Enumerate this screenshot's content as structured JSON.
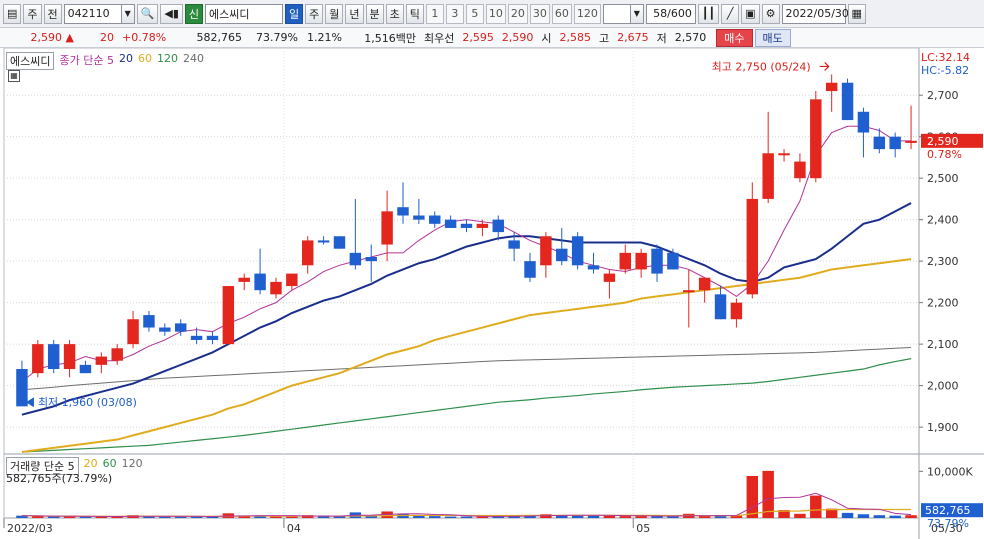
{
  "toolbar": {
    "market": "주",
    "prev_label": "전",
    "code": "042110",
    "new_label": "신",
    "name": "에스씨디",
    "periods": [
      "일",
      "주",
      "월",
      "년",
      "분",
      "초",
      "틱"
    ],
    "selected_period": "일",
    "intervals": [
      "1",
      "3",
      "5",
      "10",
      "20",
      "30",
      "60",
      "120"
    ],
    "count": "58/600",
    "date": "2022/05/30"
  },
  "quote": {
    "price": "2,590",
    "arrow": "▲",
    "change": "20",
    "change_pct": "+0.78%",
    "volume": "582,765",
    "vol_ratio": "73.79%",
    "turnover": "1.21%",
    "amount": "1,516백만",
    "best_label": "최우선",
    "ask": "2,595",
    "bid": "2,590",
    "open_label": "시",
    "open": "2,585",
    "high_label": "고",
    "high": "2,675",
    "low_label": "저",
    "low": "2,570",
    "buy_label": "매수",
    "sell_label": "매도"
  },
  "price_legend": {
    "name": "에스씨디",
    "ma_label": "종가 단순 5",
    "ma2": "20",
    "ma3": "60",
    "ma4": "120",
    "ma5": "240",
    "colors": {
      "ma5": "#b2339a",
      "ma20": "#1a2f8c",
      "ma60": "#e0ac1d",
      "ma120": "#2f8f4d",
      "ma240": "#6e6e6e"
    }
  },
  "right_labels": {
    "lc": "LC:32.14",
    "hc": "HC:-5.82",
    "current_price": "2,590",
    "current_pct": "0.78%",
    "volume_value": "582,765",
    "volume_pct": "73.79%",
    "volume_unit_tick": "10,000K"
  },
  "annotations": {
    "high": "최고 2,750 (05/24)",
    "low": "최저 1,960 (03/08)"
  },
  "volume_legend": {
    "label": "거래량 단순 5",
    "ma2": "20",
    "ma3": "60",
    "ma4": "120",
    "value": "582,765주(73.79%)"
  },
  "x_labels": [
    "2022/03",
    "04",
    "05",
    "05/30"
  ],
  "chart_data": {
    "type": "candlestick",
    "y_ticks": [
      1900,
      2000,
      2100,
      2200,
      2300,
      2400,
      2500,
      2600,
      2700
    ],
    "y_tick_labels": [
      "1,900",
      "2,000",
      "2,100",
      "2,200",
      "2,300",
      "2,400",
      "2,500",
      "2,600",
      "2,700"
    ],
    "ylim": [
      1840,
      2780
    ],
    "candles": [
      {
        "o": 2040,
        "h": 2060,
        "l": 1960,
        "c": 1950
      },
      {
        "o": 2030,
        "h": 2110,
        "l": 2020,
        "c": 2100
      },
      {
        "o": 2100,
        "h": 2110,
        "l": 2030,
        "c": 2040
      },
      {
        "o": 2040,
        "h": 2110,
        "l": 2020,
        "c": 2100
      },
      {
        "o": 2050,
        "h": 2060,
        "l": 2030,
        "c": 2030
      },
      {
        "o": 2050,
        "h": 2080,
        "l": 2030,
        "c": 2070
      },
      {
        "o": 2060,
        "h": 2100,
        "l": 2050,
        "c": 2090
      },
      {
        "o": 2100,
        "h": 2180,
        "l": 2090,
        "c": 2160
      },
      {
        "o": 2170,
        "h": 2180,
        "l": 2130,
        "c": 2140
      },
      {
        "o": 2140,
        "h": 2150,
        "l": 2120,
        "c": 2130
      },
      {
        "o": 2150,
        "h": 2160,
        "l": 2120,
        "c": 2130
      },
      {
        "o": 2120,
        "h": 2140,
        "l": 2100,
        "c": 2110
      },
      {
        "o": 2120,
        "h": 2130,
        "l": 2100,
        "c": 2110
      },
      {
        "o": 2100,
        "h": 2240,
        "l": 2100,
        "c": 2240
      },
      {
        "o": 2250,
        "h": 2270,
        "l": 2230,
        "c": 2260
      },
      {
        "o": 2270,
        "h": 2330,
        "l": 2220,
        "c": 2230
      },
      {
        "o": 2220,
        "h": 2260,
        "l": 2210,
        "c": 2250
      },
      {
        "o": 2240,
        "h": 2270,
        "l": 2230,
        "c": 2270
      },
      {
        "o": 2290,
        "h": 2360,
        "l": 2270,
        "c": 2350
      },
      {
        "o": 2350,
        "h": 2360,
        "l": 2340,
        "c": 2345
      },
      {
        "o": 2360,
        "h": 2360,
        "l": 2330,
        "c": 2330
      },
      {
        "o": 2320,
        "h": 2450,
        "l": 2280,
        "c": 2290
      },
      {
        "o": 2310,
        "h": 2340,
        "l": 2250,
        "c": 2300
      },
      {
        "o": 2340,
        "h": 2470,
        "l": 2300,
        "c": 2420
      },
      {
        "o": 2430,
        "h": 2490,
        "l": 2390,
        "c": 2410
      },
      {
        "o": 2410,
        "h": 2450,
        "l": 2390,
        "c": 2400
      },
      {
        "o": 2410,
        "h": 2420,
        "l": 2380,
        "c": 2390
      },
      {
        "o": 2400,
        "h": 2410,
        "l": 2380,
        "c": 2380
      },
      {
        "o": 2390,
        "h": 2400,
        "l": 2370,
        "c": 2380
      },
      {
        "o": 2380,
        "h": 2400,
        "l": 2360,
        "c": 2390
      },
      {
        "o": 2400,
        "h": 2410,
        "l": 2350,
        "c": 2370
      },
      {
        "o": 2350,
        "h": 2370,
        "l": 2300,
        "c": 2330
      },
      {
        "o": 2300,
        "h": 2320,
        "l": 2250,
        "c": 2260
      },
      {
        "o": 2290,
        "h": 2370,
        "l": 2260,
        "c": 2360
      },
      {
        "o": 2330,
        "h": 2380,
        "l": 2290,
        "c": 2300
      },
      {
        "o": 2360,
        "h": 2370,
        "l": 2280,
        "c": 2290
      },
      {
        "o": 2290,
        "h": 2320,
        "l": 2270,
        "c": 2280
      },
      {
        "o": 2250,
        "h": 2280,
        "l": 2210,
        "c": 2270
      },
      {
        "o": 2280,
        "h": 2340,
        "l": 2270,
        "c": 2320
      },
      {
        "o": 2280,
        "h": 2330,
        "l": 2260,
        "c": 2320
      },
      {
        "o": 2330,
        "h": 2340,
        "l": 2250,
        "c": 2270
      },
      {
        "o": 2320,
        "h": 2330,
        "l": 2280,
        "c": 2280
      },
      {
        "o": 2230,
        "h": 2280,
        "l": 2140,
        "c": 2230
      },
      {
        "o": 2230,
        "h": 2260,
        "l": 2200,
        "c": 2260
      },
      {
        "o": 2220,
        "h": 2240,
        "l": 2160,
        "c": 2160
      },
      {
        "o": 2160,
        "h": 2210,
        "l": 2140,
        "c": 2200
      },
      {
        "o": 2220,
        "h": 2490,
        "l": 2210,
        "c": 2450
      },
      {
        "o": 2450,
        "h": 2660,
        "l": 2440,
        "c": 2560
      },
      {
        "o": 2560,
        "h": 2570,
        "l": 2540,
        "c": 2560
      },
      {
        "o": 2500,
        "h": 2560,
        "l": 2490,
        "c": 2540
      },
      {
        "o": 2500,
        "h": 2710,
        "l": 2490,
        "c": 2690
      },
      {
        "o": 2710,
        "h": 2750,
        "l": 2660,
        "c": 2730
      },
      {
        "o": 2730,
        "h": 2740,
        "l": 2640,
        "c": 2640
      },
      {
        "o": 2660,
        "h": 2670,
        "l": 2550,
        "c": 2610
      },
      {
        "o": 2600,
        "h": 2620,
        "l": 2560,
        "c": 2570
      },
      {
        "o": 2600,
        "h": 2610,
        "l": 2550,
        "c": 2570
      },
      {
        "o": 2585,
        "h": 2675,
        "l": 2570,
        "c": 2590
      }
    ],
    "ma5": [
      2010,
      2040,
      2050,
      2055,
      2070,
      2060,
      2060,
      2075,
      2095,
      2110,
      2130,
      2135,
      2130,
      2150,
      2165,
      2185,
      2200,
      2230,
      2250,
      2275,
      2290,
      2300,
      2310,
      2320,
      2320,
      2350,
      2375,
      2395,
      2400,
      2395,
      2390,
      2370,
      2350,
      2335,
      2320,
      2300,
      2290,
      2280,
      2275,
      2285,
      2290,
      2290,
      2280,
      2260,
      2240,
      2215,
      2245,
      2300,
      2375,
      2445,
      2555,
      2610,
      2625,
      2625,
      2615,
      2590,
      2590
    ],
    "ma20": [
      1930,
      1940,
      1950,
      1965,
      1975,
      1985,
      1995,
      2005,
      2020,
      2035,
      2050,
      2065,
      2080,
      2100,
      2120,
      2140,
      2155,
      2175,
      2190,
      2205,
      2215,
      2230,
      2245,
      2265,
      2280,
      2295,
      2305,
      2320,
      2335,
      2345,
      2355,
      2360,
      2360,
      2355,
      2350,
      2345,
      2345,
      2345,
      2345,
      2345,
      2335,
      2320,
      2305,
      2290,
      2270,
      2255,
      2250,
      2260,
      2285,
      2295,
      2305,
      2330,
      2360,
      2390,
      2400,
      2420,
      2440
    ],
    "ma60": [
      1840,
      1845,
      1850,
      1855,
      1860,
      1865,
      1870,
      1880,
      1890,
      1900,
      1910,
      1920,
      1930,
      1945,
      1955,
      1970,
      1985,
      2000,
      2010,
      2020,
      2030,
      2045,
      2060,
      2075,
      2085,
      2095,
      2110,
      2120,
      2130,
      2140,
      2150,
      2160,
      2170,
      2175,
      2180,
      2185,
      2190,
      2195,
      2200,
      2210,
      2215,
      2220,
      2225,
      2230,
      2235,
      2240,
      2245,
      2250,
      2255,
      2260,
      2270,
      2280,
      2285,
      2290,
      2295,
      2300,
      2305
    ],
    "ma120": [
      1840,
      1842,
      1844,
      1846,
      1848,
      1850,
      1852,
      1854,
      1856,
      1860,
      1864,
      1868,
      1872,
      1876,
      1880,
      1885,
      1890,
      1895,
      1900,
      1905,
      1910,
      1915,
      1920,
      1925,
      1930,
      1935,
      1940,
      1945,
      1950,
      1955,
      1960,
      1963,
      1966,
      1970,
      1973,
      1976,
      1980,
      1983,
      1986,
      1990,
      1993,
      1996,
      1998,
      2000,
      2002,
      2004,
      2006,
      2010,
      2015,
      2020,
      2025,
      2030,
      2035,
      2040,
      2050,
      2058,
      2065
    ],
    "ma240": [
      1990,
      1993,
      1996,
      2000,
      2003,
      2006,
      2009,
      2012,
      2015,
      2018,
      2020,
      2022,
      2024,
      2026,
      2028,
      2030,
      2032,
      2034,
      2036,
      2038,
      2040,
      2042,
      2044,
      2046,
      2048,
      2050,
      2052,
      2054,
      2056,
      2058,
      2060,
      2061,
      2062,
      2063,
      2064,
      2065,
      2066,
      2067,
      2068,
      2069,
      2070,
      2071,
      2072,
      2073,
      2074,
      2075,
      2076,
      2077,
      2078,
      2079,
      2080,
      2082,
      2084,
      2086,
      2088,
      2090,
      2092
    ],
    "volume": [
      0.5,
      0.4,
      0.3,
      0.4,
      0.3,
      0.3,
      0.3,
      0.6,
      0.4,
      0.3,
      0.3,
      0.3,
      0.3,
      1.0,
      0.4,
      0.5,
      0.3,
      0.3,
      0.6,
      0.4,
      0.4,
      1.2,
      0.5,
      1.4,
      0.9,
      0.5,
      0.4,
      0.3,
      0.3,
      0.3,
      0.4,
      0.5,
      0.6,
      0.8,
      0.5,
      0.6,
      0.5,
      0.5,
      0.4,
      0.4,
      0.4,
      0.3,
      0.9,
      0.4,
      0.6,
      0.5,
      9.0,
      10.1,
      1.7,
      0.9,
      4.8,
      2.0,
      1.1,
      0.8,
      0.6,
      0.5,
      0.6
    ],
    "volume_ylim": [
      0,
      12
    ]
  }
}
